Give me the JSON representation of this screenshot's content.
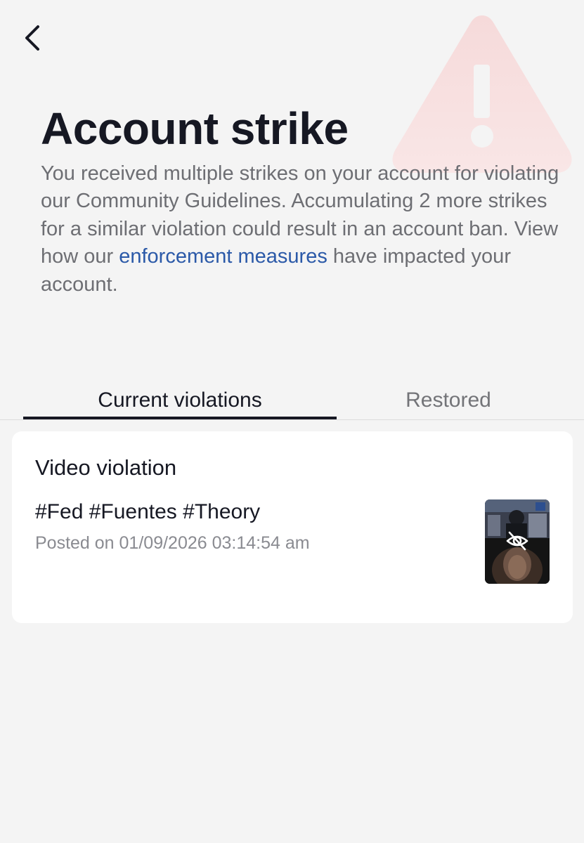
{
  "header": {
    "back_icon": "chevron-left-icon",
    "warning_icon": "warning-triangle-icon",
    "title": "Account strike"
  },
  "description": {
    "text_before": "You received multiple strikes on your account for violating our Community Guidelines. Accumulating 2 more strikes for a similar violation could result in an account ban. View how our ",
    "link_text": "enforcement measures",
    "text_after": " have impacted your account."
  },
  "tabs": [
    {
      "label": "Current violations",
      "selected": true
    },
    {
      "label": "Restored",
      "selected": false
    }
  ],
  "violation": {
    "type_label": "Video violation",
    "caption": "#Fed #Fuentes #Theory",
    "posted": "Posted on 01/09/2026 03:14:54 am",
    "thumbnail_icon": "eye-off-icon"
  },
  "colors": {
    "background": "#f4f4f4",
    "title": "#161823",
    "body_text": "#6d6e73",
    "link": "#2b59a8",
    "warning_watermark": "#f6dcdc",
    "card": "#ffffff"
  }
}
